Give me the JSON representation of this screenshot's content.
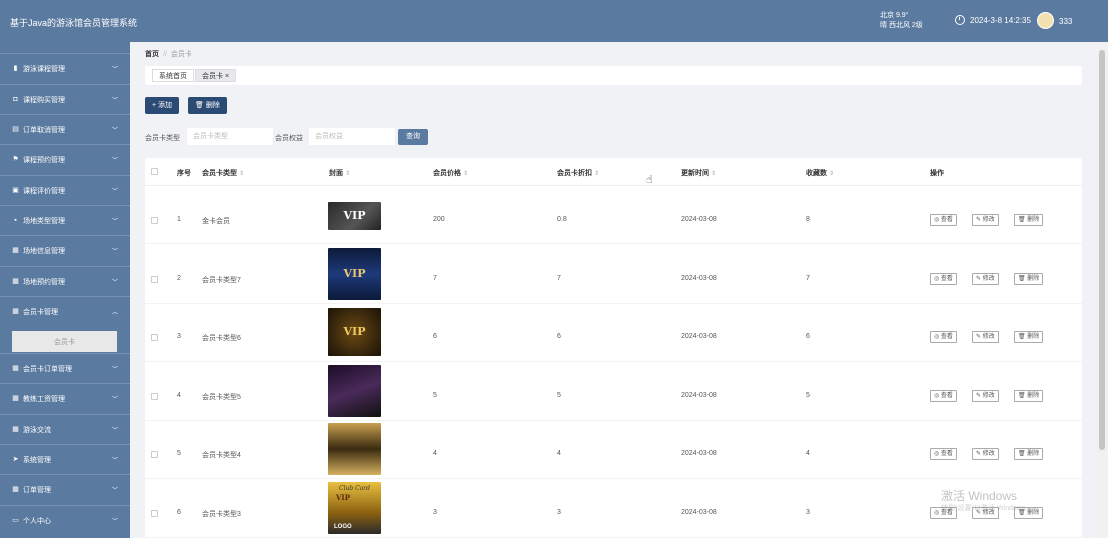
{
  "header": {
    "app_title": "基于Java的游泳馆会员管理系统",
    "weather_city": "北京  9.9°",
    "weather_desc": "晴  西北风  2级",
    "datetime": "2024-3-8 14:2:35",
    "username": "333"
  },
  "sidebar": {
    "items": [
      {
        "label": "游泳课程管理",
        "icon": "bar-chart-icon"
      },
      {
        "label": "课程购买管理",
        "icon": "cart-icon"
      },
      {
        "label": "订单取消管理",
        "icon": "note-icon"
      },
      {
        "label": "课程预约管理",
        "icon": "flag-icon"
      },
      {
        "label": "课程评价管理",
        "icon": "image-icon"
      },
      {
        "label": "场地类型管理",
        "icon": "bag-icon"
      },
      {
        "label": "场地信息管理",
        "icon": "grid-icon"
      },
      {
        "label": "场地预约管理",
        "icon": "grid-icon"
      },
      {
        "label": "会员卡管理",
        "icon": "grid-icon"
      },
      {
        "label": "会员卡订单管理",
        "icon": "grid-icon"
      },
      {
        "label": "教练工资管理",
        "icon": "grid-icon"
      },
      {
        "label": "游泳交流",
        "icon": "grid-icon"
      },
      {
        "label": "系统管理",
        "icon": "send-icon"
      },
      {
        "label": "订单管理",
        "icon": "grid-icon"
      },
      {
        "label": "个人中心",
        "icon": "window-icon"
      }
    ],
    "active_sub": "会员卡"
  },
  "breadcrumb": {
    "home": "首页",
    "current": "会员卡"
  },
  "tabs": [
    {
      "label": "系统首页"
    },
    {
      "label": "会员卡 ×"
    }
  ],
  "toolbar": {
    "add_label": "+ 添加",
    "delete_label": "删除"
  },
  "search": {
    "type_label": "会员卡类型",
    "type_placeholder": "会员卡类型",
    "rights_label": "会员权益",
    "rights_placeholder": "会员权益",
    "query_label": "查询"
  },
  "table": {
    "headers": [
      "序号",
      "会员卡类型",
      "封面",
      "会员价格",
      "会员卡折扣",
      "更新时间",
      "收藏数",
      "操作"
    ],
    "sortable_mark": "⇕",
    "rows": [
      {
        "index": "1",
        "type": "金卡会员",
        "price": "200",
        "discount": "0.8",
        "updated": "2024-03-08",
        "favorites": "8"
      },
      {
        "index": "2",
        "type": "会员卡类型7",
        "price": "7",
        "discount": "7",
        "updated": "2024-03-08",
        "favorites": "7"
      },
      {
        "index": "3",
        "type": "会员卡类型6",
        "price": "6",
        "discount": "6",
        "updated": "2024-03-08",
        "favorites": "6"
      },
      {
        "index": "4",
        "type": "会员卡类型5",
        "price": "5",
        "discount": "5",
        "updated": "2024-03-08",
        "favorites": "5"
      },
      {
        "index": "5",
        "type": "会员卡类型4",
        "price": "4",
        "discount": "4",
        "updated": "2024-03-08",
        "favorites": "4"
      },
      {
        "index": "6",
        "type": "会员卡类型3",
        "price": "3",
        "discount": "3",
        "updated": "2024-03-08",
        "favorites": "3"
      }
    ],
    "actions": {
      "view": "查看",
      "edit": "修改",
      "delete": "删除"
    }
  },
  "covers": {
    "vip_text": "VIP",
    "club_text": "Club Card",
    "logo_text": "LOGO"
  },
  "watermark": {
    "line1": "激活 Windows",
    "line2": "转到\"设置\"以激活 Windows。"
  }
}
